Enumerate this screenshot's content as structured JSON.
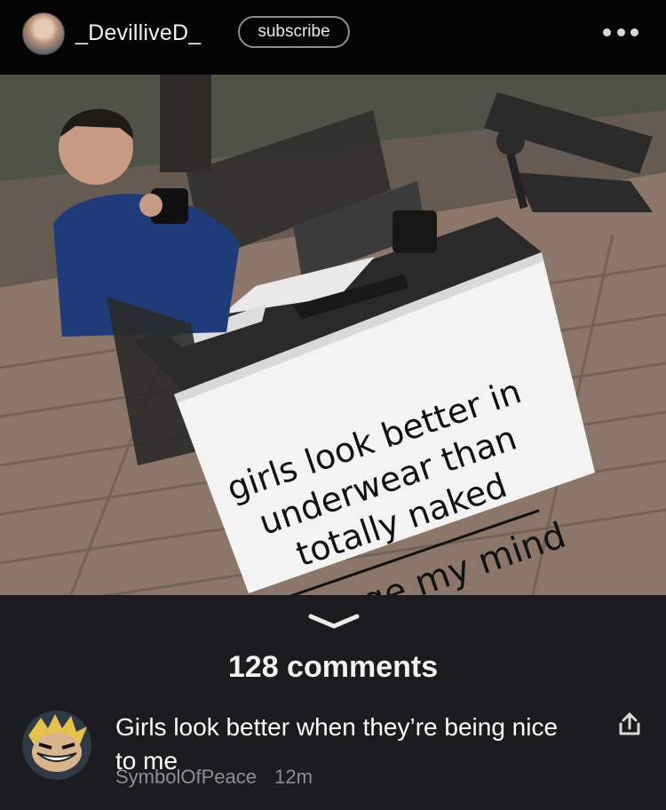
{
  "header": {
    "username": "_DevilliveD_",
    "subscribe_label": "subscribe",
    "more_icon": "more-dots-icon"
  },
  "post": {
    "meme_sign_text": "girls look better in underwear than totally naked",
    "meme_caption": "change my mind",
    "comments_count_label": "128 comments"
  },
  "comment": {
    "text": "Girls look better when they’re being nice to me",
    "author": "SymbolOfPeace",
    "time": "12m",
    "share_icon": "share-icon"
  },
  "colors": {
    "background": "#1c1c1e",
    "topbar": "#050505",
    "muted_text": "#8e8e93"
  }
}
